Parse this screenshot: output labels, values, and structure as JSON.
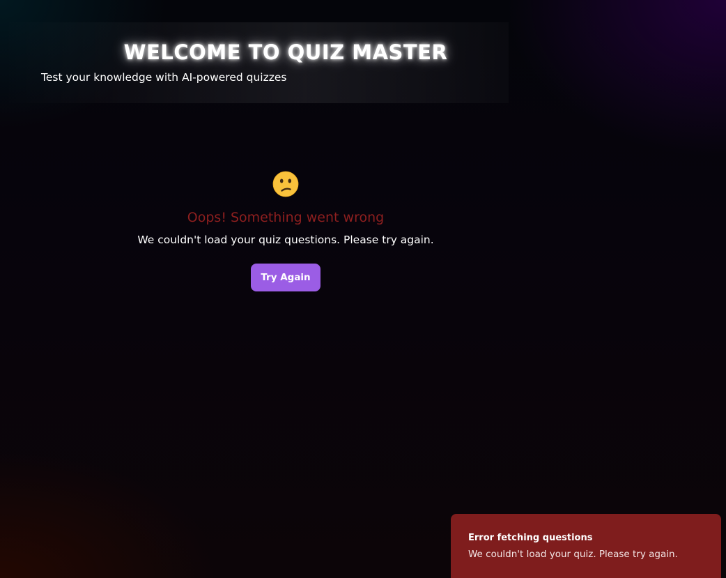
{
  "header": {
    "title": "WELCOME TO QUIZ MASTER",
    "subtitle": "Test your knowledge with AI-powered quizzes"
  },
  "error": {
    "icon": "confused-face-icon",
    "heading": "Oops! Something went wrong",
    "message": "We couldn't load your quiz questions. Please try again.",
    "retry_label": "Try Again"
  },
  "toast": {
    "title": "Error fetching questions",
    "message": "We couldn't load your quiz. Please try again."
  },
  "colors": {
    "accent": "#9b5de5",
    "error_text": "#8e1f1f",
    "toast_background": "#7f1d1d",
    "emoji_yellow": "#f9c23c"
  }
}
